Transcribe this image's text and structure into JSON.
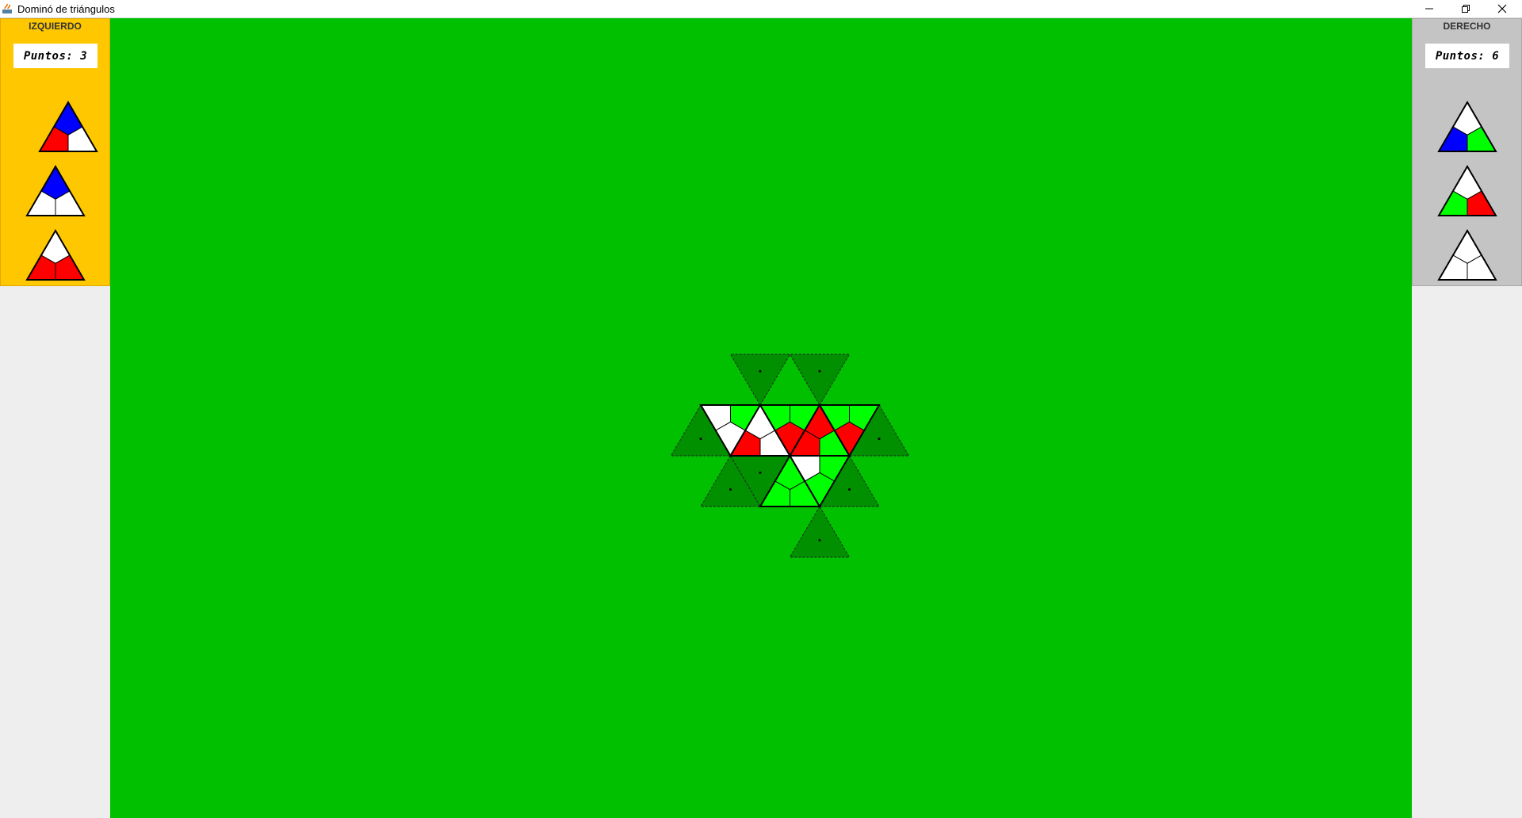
{
  "window": {
    "title": "Dominó de triángulos",
    "minimize_icon": "minimize-icon",
    "restore_icon": "restore-icon",
    "close_icon": "close-icon"
  },
  "colors": {
    "board": "#00c000",
    "slot": "#009000",
    "red": "#ff0000",
    "blue": "#0000ff",
    "green": "#00ff00",
    "white": "#ffffff",
    "left_panel": "#ffc700",
    "right_panel": "#c4c4c4"
  },
  "left_player": {
    "name": "IZQUIERDO",
    "score": "Puntos: 3",
    "pieces": [
      {
        "top": "blue",
        "left": "red",
        "right": "white"
      },
      {
        "top": "blue",
        "left": "white",
        "right": "white"
      },
      {
        "top": "white",
        "left": "red",
        "right": "red"
      }
    ]
  },
  "right_player": {
    "name": "DERECHO",
    "score": "Puntos: 6",
    "pieces": [
      {
        "top": "white",
        "left": "blue",
        "right": "green"
      },
      {
        "top": "white",
        "left": "green",
        "right": "red"
      },
      {
        "top": "white",
        "left": "white",
        "right": "white"
      }
    ]
  },
  "board": {
    "placed_tiles": [
      {
        "cell": "r1c2",
        "up": true,
        "zones": [
          "white",
          "green",
          "white"
        ]
      },
      {
        "cell": "r1c3",
        "up": false,
        "zones": [
          "white",
          "red",
          "white"
        ]
      },
      {
        "cell": "r1c4",
        "up": true,
        "zones": [
          "red",
          "green",
          "green"
        ]
      },
      {
        "cell": "r1c5",
        "up": false,
        "zones": [
          "red",
          "red",
          "green"
        ]
      },
      {
        "cell": "r1c6",
        "up": true,
        "zones": [
          "red",
          "green",
          "green"
        ]
      },
      {
        "cell": "r2c4",
        "up": false,
        "zones": [
          "green",
          "green",
          "green"
        ]
      },
      {
        "cell": "r2c5",
        "up": true,
        "zones": [
          "green",
          "green",
          "white"
        ]
      }
    ],
    "open_slots": [
      "r0c3",
      "r0c5",
      "r1c1",
      "r1c7",
      "r2c2",
      "r2c3",
      "r2c6",
      "r3c5"
    ]
  }
}
